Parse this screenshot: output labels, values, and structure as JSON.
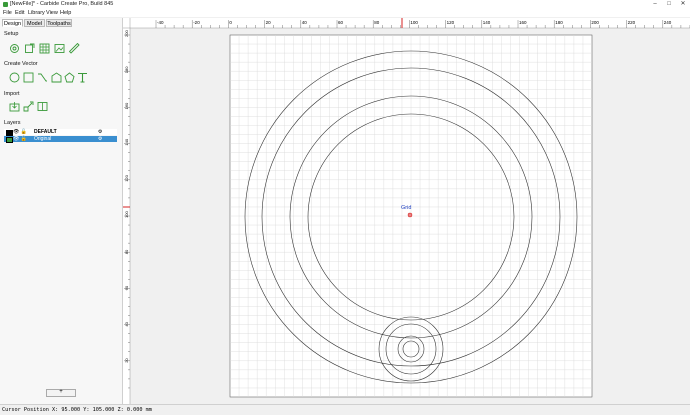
{
  "window": {
    "title": "[NewFile]* - Carbide Create Pro, Build 845",
    "minimize_glyph": "–",
    "maximize_glyph": "□",
    "close_glyph": "✕"
  },
  "menu": [
    "File",
    "Edit",
    "Library",
    "View",
    "Help"
  ],
  "tabs": [
    "Design",
    "Model",
    "Toolpaths"
  ],
  "sections": {
    "setup": "Setup",
    "create_vector": "Create Vector",
    "import": "Import",
    "layers": "Layers"
  },
  "tools": {
    "setup": [
      "job-setup-icon",
      "edit-stock-icon",
      "grid-icon",
      "image-icon",
      "ruler-icon"
    ],
    "create_vector": [
      "circle-icon",
      "rectangle-icon",
      "curve-icon",
      "polygon-icon",
      "pentagon-icon",
      "text-icon"
    ],
    "import": [
      "import-svg-icon",
      "import-dxf-icon",
      "import-book-icon"
    ]
  },
  "colors": {
    "accent_green": "#3a9a3a",
    "layer_selected_bg": "#3a8fd0",
    "marker_red": "#d62020",
    "origin_blue": "#2040c0"
  },
  "layers": [
    {
      "name": "DEFAULT",
      "color": "#000000",
      "selected": false
    },
    {
      "name": "Original",
      "color": "#3a9a3a",
      "selected": true
    }
  ],
  "add_layer_label": "+",
  "ruler": {
    "h_labels": [
      "-40",
      "-20",
      "0",
      "20",
      "40",
      "60",
      "80",
      "100",
      "120",
      "140",
      "160",
      "180",
      "200",
      "220",
      "240"
    ],
    "v_labels": [
      "200",
      "180",
      "160",
      "140",
      "120",
      "100",
      "80",
      "60",
      "40",
      "20"
    ]
  },
  "canvas": {
    "grid_label": "Grid"
  },
  "status": {
    "cursor_text": "Cursor Position X: 95.000 Y: 105.000 Z: 0.000 mm"
  }
}
